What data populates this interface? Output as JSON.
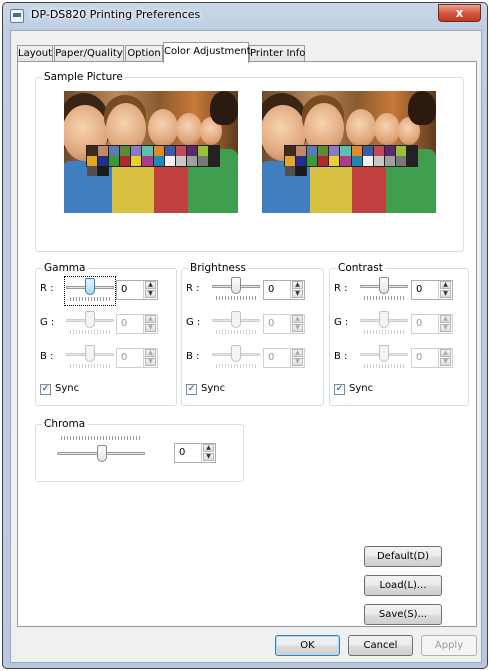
{
  "window": {
    "title": "DP-DS820 Printing Preferences",
    "close_label": "x"
  },
  "tabs": [
    {
      "label": "Layout"
    },
    {
      "label": "Paper/Quality"
    },
    {
      "label": "Option"
    },
    {
      "label": "Color Adjustment"
    },
    {
      "label": "Printer Info"
    }
  ],
  "sample": {
    "title": "Sample Picture"
  },
  "gamma": {
    "title": "Gamma",
    "r_label": "R :",
    "g_label": "G :",
    "b_label": "B :",
    "r_value": "0",
    "g_value": "0",
    "b_value": "0",
    "sync_label": "Sync",
    "sync_checked": true
  },
  "brightness": {
    "title": "Brightness",
    "r_label": "R :",
    "g_label": "G :",
    "b_label": "B :",
    "r_value": "0",
    "g_value": "0",
    "b_value": "0",
    "sync_label": "Sync",
    "sync_checked": true
  },
  "contrast": {
    "title": "Contrast",
    "r_label": "R :",
    "g_label": "G :",
    "b_label": "B :",
    "r_value": "0",
    "g_value": "0",
    "b_value": "0",
    "sync_label": "Sync",
    "sync_checked": true
  },
  "chroma": {
    "title": "Chroma",
    "value": "0"
  },
  "buttons": {
    "default_label": "Default(D)",
    "load_label": "Load(L)...",
    "save_label": "Save(S)...",
    "ok_label": "OK",
    "cancel_label": "Cancel",
    "apply_label": "Apply"
  },
  "colors": {
    "title_bar": "#c9d7e8",
    "close": "#c23a22",
    "focus_thumb": "#a9dbf6"
  }
}
